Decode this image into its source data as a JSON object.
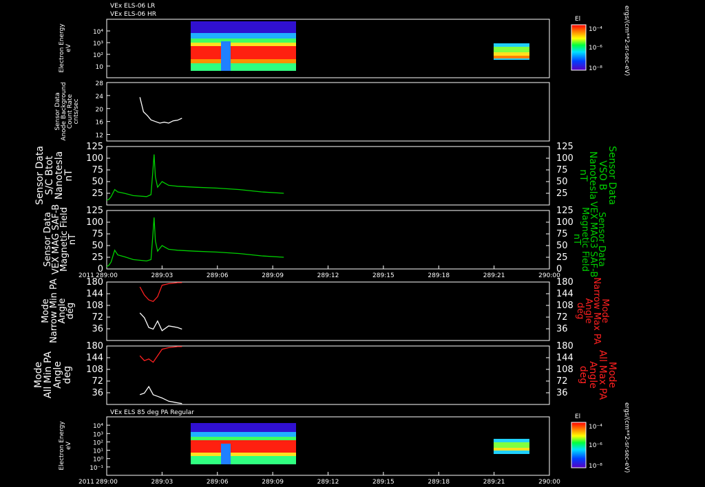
{
  "chart_data": [
    {
      "type": "heatmap",
      "titles": [
        "VEx ELS-06 LR",
        "VEx ELS-06 HR"
      ],
      "ylabel": [
        "Electron Energy",
        "eV"
      ],
      "y_ticks": [
        "10",
        "10²",
        "10³",
        "10⁴"
      ],
      "log_y": true,
      "colorbar": {
        "label": "El",
        "ticks": [
          "10⁻⁴",
          "10⁻⁶",
          "10⁻⁸"
        ],
        "units": "ergs/(cm**2-sr-sec-eV)"
      }
    },
    {
      "type": "line",
      "ylabel": [
        "Sensor Data",
        "Anode Background",
        "Count Rate",
        "cnts/sec"
      ],
      "ylim": [
        10,
        28
      ],
      "y_ticks": [
        "12",
        "16",
        "20",
        "24",
        "28"
      ],
      "series": [
        {
          "color": "#ffffff",
          "x": [
            289.075,
            289.083,
            289.092,
            289.1,
            289.11,
            289.12,
            289.13,
            289.14,
            289.15,
            289.16,
            289.17
          ],
          "values": [
            23.5,
            19,
            17.8,
            16.5,
            16,
            15.5,
            15.8,
            15.5,
            16.2,
            16.4,
            17
          ]
        }
      ]
    },
    {
      "type": "line",
      "ylabel_left": [
        "Sensor Data",
        "S/C Btot",
        "Nanotesla",
        "nT"
      ],
      "ylabel_right": [
        "Sensor Data",
        "VSO B",
        "Nanotesla",
        "nT"
      ],
      "ylim": [
        0,
        125
      ],
      "y_ticks": [
        "25",
        "50",
        "75",
        "100",
        "125"
      ],
      "series": [
        {
          "color": "#00d000",
          "x": [
            289.0,
            289.005,
            289.01,
            289.018,
            289.025,
            289.04,
            289.06,
            289.09,
            289.1,
            289.104,
            289.107,
            289.11,
            289.115,
            289.125,
            289.14,
            289.16,
            289.2,
            289.25,
            289.3,
            289.35,
            289.4
          ],
          "values": [
            10,
            12,
            18,
            33,
            28,
            25,
            20,
            18,
            22,
            70,
            108,
            60,
            38,
            50,
            42,
            40,
            38,
            36,
            33,
            28,
            25
          ]
        }
      ]
    },
    {
      "type": "line",
      "ylabel_left": [
        "Sensor Data",
        "VEX MAG SAF-B",
        "Magnetic Field",
        "nT"
      ],
      "ylabel_right": [
        "Sensor Data",
        "VEX MAG3 SAF-B",
        "Magnetic Field",
        "nT"
      ],
      "ylim": [
        0,
        125
      ],
      "y_ticks": [
        "0",
        "25",
        "50",
        "75",
        "100",
        "125"
      ],
      "series": [
        {
          "color": "#00d000",
          "x": [
            289.0,
            289.005,
            289.01,
            289.018,
            289.025,
            289.04,
            289.06,
            289.09,
            289.1,
            289.104,
            289.107,
            289.11,
            289.115,
            289.125,
            289.14,
            289.16,
            289.2,
            289.25,
            289.3,
            289.35,
            289.4
          ],
          "values": [
            5,
            8,
            15,
            40,
            30,
            26,
            20,
            17,
            20,
            70,
            110,
            60,
            38,
            50,
            42,
            40,
            38,
            36,
            33,
            28,
            25
          ]
        }
      ]
    },
    {
      "type": "line",
      "ylabel_left": [
        "Mode",
        "Narrow Min PA",
        "Angle",
        "deg"
      ],
      "ylabel_right": [
        "Mode",
        "Narrow Max PA",
        "Angle",
        "deg"
      ],
      "ylim": [
        0,
        180
      ],
      "y_ticks": [
        "36",
        "72",
        "108",
        "144",
        "180"
      ],
      "series": [
        {
          "color": "#ffffff",
          "x": [
            289.075,
            289.085,
            289.095,
            289.105,
            289.115,
            289.125,
            289.14,
            289.16,
            289.17
          ],
          "values": [
            85,
            70,
            40,
            35,
            60,
            30,
            45,
            40,
            35
          ]
        },
        {
          "color": "#ff2020",
          "x": [
            289.075,
            289.085,
            289.095,
            289.105,
            289.115,
            289.125,
            289.14,
            289.16,
            289.17
          ],
          "values": [
            165,
            140,
            125,
            120,
            135,
            170,
            175,
            178,
            178
          ]
        }
      ]
    },
    {
      "type": "line",
      "ylabel_left": [
        "Mode",
        "All Min PA",
        "Angle",
        "deg"
      ],
      "ylabel_right": [
        "Mode",
        "All Max PA",
        "Angle",
        "deg"
      ],
      "ylim": [
        0,
        180
      ],
      "y_ticks": [
        "36",
        "72",
        "108",
        "144",
        "180"
      ],
      "series": [
        {
          "color": "#ffffff",
          "x": [
            289.075,
            289.085,
            289.095,
            289.105,
            289.115,
            289.125,
            289.14,
            289.16,
            289.17
          ],
          "values": [
            30,
            35,
            55,
            30,
            25,
            20,
            10,
            5,
            3
          ]
        },
        {
          "color": "#ff2020",
          "x": [
            289.075,
            289.085,
            289.095,
            289.105,
            289.115,
            289.125,
            289.14,
            289.16,
            289.17
          ],
          "values": [
            150,
            135,
            140,
            130,
            150,
            170,
            175,
            178,
            178
          ]
        }
      ]
    },
    {
      "type": "heatmap",
      "titles": [
        "VEx ELS 85 deg PA Regular"
      ],
      "ylabel": [
        "Electron Energy",
        "eV"
      ],
      "y_ticks": [
        "10⁻¹",
        "10⁰",
        "10¹",
        "10²",
        "10³",
        "10⁴"
      ],
      "log_y": true,
      "colorbar": {
        "label": "El",
        "ticks": [
          "10⁻⁴",
          "10⁻⁶",
          "10⁻⁸"
        ],
        "units": "ergs/(cm**2-sr-sec-eV)"
      }
    }
  ],
  "x_axis": {
    "year": "2011",
    "ticks": [
      "289:00",
      "289:03",
      "289:06",
      "289:09",
      "289:12",
      "289:15",
      "289:18",
      "289:21",
      "290:00"
    ]
  }
}
